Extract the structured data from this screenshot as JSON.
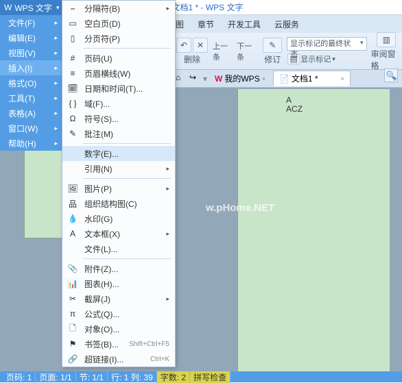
{
  "title": {
    "doc": "文档1 *",
    "app": "WPS 文字"
  },
  "ribbontabs": [
    "图",
    "章节",
    "开发工具",
    "云服务"
  ],
  "toolbar": {
    "undo": "←",
    "del": "删除",
    "prev": "上一条",
    "next": "下一条",
    "revise": "修订",
    "track_combo": "显示标记的最终状态",
    "show_marks": "显示标记",
    "pane": "审阅窗格"
  },
  "subtabs": {
    "wps": "我的WPS",
    "doc": "文档1 *"
  },
  "menubar": {
    "app": "WPS 文字",
    "items": [
      "文件(F)",
      "编辑(E)",
      "视图(V)",
      "插入(I)",
      "格式(O)",
      "工具(T)",
      "表格(A)",
      "窗口(W)",
      "帮助(H)"
    ],
    "selected_index": 3
  },
  "insert_menu": [
    {
      "ic": "⎯",
      "lbl": "分隔符(B)",
      "arr": true
    },
    {
      "ic": "▭",
      "lbl": "空白页(D)"
    },
    {
      "ic": "▯",
      "lbl": "分页符(P)"
    },
    {
      "sep": true
    },
    {
      "ic": "#",
      "lbl": "页码(U)"
    },
    {
      "ic": "≡",
      "lbl": "页眉横线(W)"
    },
    {
      "ic": "🗓",
      "lbl": "日期和时间(T)..."
    },
    {
      "ic": "{ }",
      "lbl": "域(F)..."
    },
    {
      "ic": "Ω",
      "lbl": "符号(S)..."
    },
    {
      "ic": "✎",
      "lbl": "批注(M)"
    },
    {
      "sep": true
    },
    {
      "ic": "",
      "lbl": "数字(E)...",
      "hov": true
    },
    {
      "ic": "",
      "lbl": "引用(N)",
      "arr": true
    },
    {
      "sep": true
    },
    {
      "ic": "🖼",
      "lbl": "图片(P)",
      "arr": true
    },
    {
      "ic": "品",
      "lbl": "组织结构图(C)"
    },
    {
      "ic": "💧",
      "lbl": "水印(G)"
    },
    {
      "ic": "A",
      "lbl": "文本框(X)",
      "arr": true
    },
    {
      "ic": "",
      "lbl": "文件(L)..."
    },
    {
      "sep": true
    },
    {
      "ic": "📎",
      "lbl": "附件(Z)..."
    },
    {
      "ic": "📊",
      "lbl": "图表(H)..."
    },
    {
      "ic": "✂",
      "lbl": "截屏(J)",
      "arr": true
    },
    {
      "ic": "π",
      "lbl": "公式(Q)..."
    },
    {
      "ic": "🗋",
      "lbl": "对象(O)..."
    },
    {
      "ic": "⚑",
      "lbl": "书签(B)...",
      "sc": "Shift+Ctrl+F5"
    },
    {
      "ic": "🔗",
      "lbl": "超链接(I)...",
      "sc": "Ctrl+K"
    }
  ],
  "doc_content": {
    "l1": "A",
    "l2": "ACZ"
  },
  "watermark": "w.pHome.NET",
  "status": {
    "page": "页码: 1",
    "pages": "页面: 1/1",
    "sec": "节: 1/1",
    "rowcol": "行: 1  列: 39",
    "words": "字数: 2",
    "spell": "拼写检查"
  }
}
